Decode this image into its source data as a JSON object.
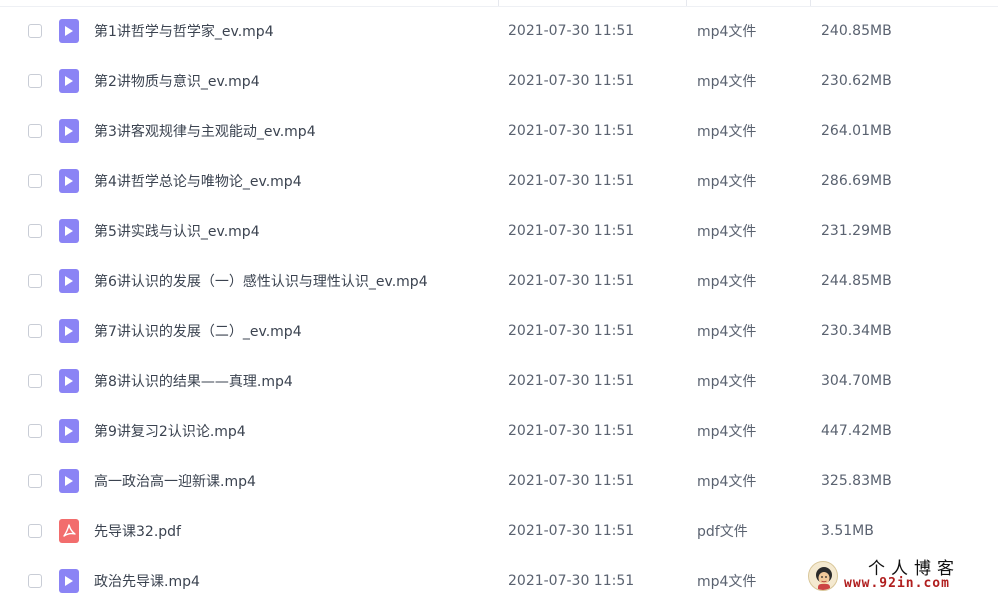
{
  "files": [
    {
      "name": "第1讲哲学与哲学家_ev.mp4",
      "date": "2021-07-30 11:51",
      "type": "mp4文件",
      "size": "240.85MB",
      "icon": "video-file-icon"
    },
    {
      "name": "第2讲物质与意识_ev.mp4",
      "date": "2021-07-30 11:51",
      "type": "mp4文件",
      "size": "230.62MB",
      "icon": "video-file-icon"
    },
    {
      "name": "第3讲客观规律与主观能动_ev.mp4",
      "date": "2021-07-30 11:51",
      "type": "mp4文件",
      "size": "264.01MB",
      "icon": "video-file-icon"
    },
    {
      "name": "第4讲哲学总论与唯物论_ev.mp4",
      "date": "2021-07-30 11:51",
      "type": "mp4文件",
      "size": "286.69MB",
      "icon": "video-file-icon"
    },
    {
      "name": "第5讲实践与认识_ev.mp4",
      "date": "2021-07-30 11:51",
      "type": "mp4文件",
      "size": "231.29MB",
      "icon": "video-file-icon"
    },
    {
      "name": "第6讲认识的发展（一）感性认识与理性认识_ev.mp4",
      "date": "2021-07-30 11:51",
      "type": "mp4文件",
      "size": "244.85MB",
      "icon": "video-file-icon"
    },
    {
      "name": "第7讲认识的发展（二）_ev.mp4",
      "date": "2021-07-30 11:51",
      "type": "mp4文件",
      "size": "230.34MB",
      "icon": "video-file-icon"
    },
    {
      "name": "第8讲认识的结果——真理.mp4",
      "date": "2021-07-30 11:51",
      "type": "mp4文件",
      "size": "304.70MB",
      "icon": "video-file-icon"
    },
    {
      "name": "第9讲复习2认识论.mp4",
      "date": "2021-07-30 11:51",
      "type": "mp4文件",
      "size": "447.42MB",
      "icon": "video-file-icon"
    },
    {
      "name": "高一政治高一迎新课.mp4",
      "date": "2021-07-30 11:51",
      "type": "mp4文件",
      "size": "325.83MB",
      "icon": "video-file-icon"
    },
    {
      "name": "先导课32.pdf",
      "date": "2021-07-30 11:51",
      "type": "pdf文件",
      "size": "3.51MB",
      "icon": "pdf-file-icon"
    },
    {
      "name": "政治先导课.mp4",
      "date": "2021-07-30 11:51",
      "type": "mp4文件",
      "size": "",
      "icon": "video-file-icon"
    }
  ],
  "watermark": {
    "title": "个人博客",
    "url": "www.92in.com"
  },
  "colors": {
    "video_icon": "#8b84f5",
    "pdf_icon": "#f26d6d",
    "text_primary": "#3b4350",
    "text_secondary": "#5a6270",
    "watermark_url": "#b01e1e"
  }
}
